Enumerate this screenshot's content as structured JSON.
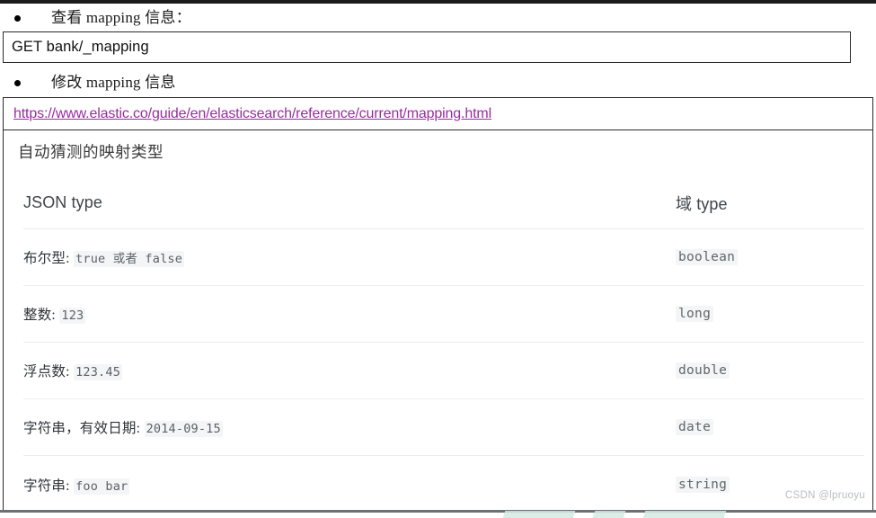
{
  "document": {
    "bullets": [
      {
        "label": "查看 mapping 信息："
      },
      {
        "label": "修改 mapping 信息"
      }
    ],
    "code_box": {
      "value": "GET bank/_mapping"
    },
    "link": {
      "text": "https://www.elastic.co/guide/en/elasticsearch/reference/current/mapping.html",
      "color": "#9a2ba0"
    },
    "section": {
      "heading": "自动猜测的映射类型",
      "table": {
        "headers": [
          "JSON type",
          "域 type"
        ],
        "rows": [
          {
            "json_type_prefix": "布尔型:",
            "json_type_code": "true 或者 false",
            "field_type": "boolean"
          },
          {
            "json_type_prefix": "整数:",
            "json_type_code": "123",
            "field_type": "long"
          },
          {
            "json_type_prefix": "浮点数:",
            "json_type_code": "123.45",
            "field_type": "double"
          },
          {
            "json_type_prefix": "字符串，有效日期:",
            "json_type_code": "2014-09-15",
            "field_type": "date"
          },
          {
            "json_type_prefix": "字符串:",
            "json_type_code": "foo bar",
            "field_type": "string"
          }
        ]
      }
    },
    "watermark": "CSDN @lpruoyu"
  }
}
